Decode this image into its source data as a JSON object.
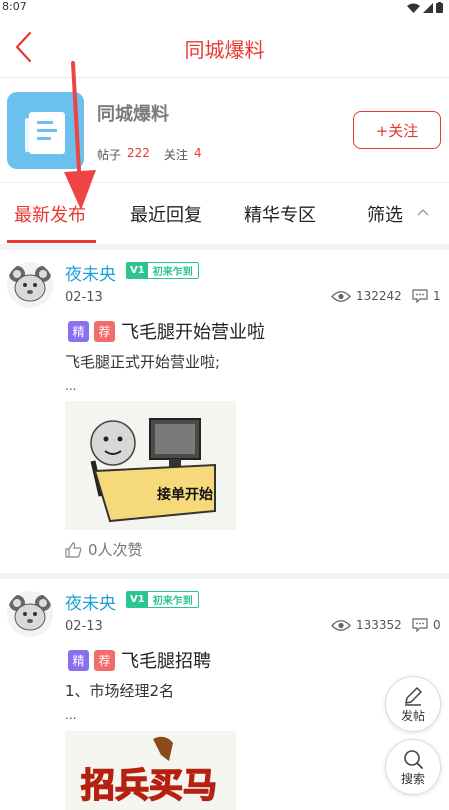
{
  "status_bar": {
    "time": "8:07"
  },
  "nav": {
    "title": "同城爆料"
  },
  "forum": {
    "name": "同城爆料",
    "posts_label": "帖子",
    "posts_count": "222",
    "follow_label": "关注",
    "follow_count": "4",
    "follow_button": "+关注"
  },
  "tabs": [
    {
      "label": "最新发布",
      "active": true
    },
    {
      "label": "最近回复"
    },
    {
      "label": "精华专区"
    },
    {
      "label": "筛选"
    }
  ],
  "posts": [
    {
      "username": "夜未央",
      "level_code": "V1",
      "level_title": "初来乍到",
      "date": "02-13",
      "views": "132242",
      "comments": "1",
      "tags": [
        "精",
        "荐"
      ],
      "title": "飞毛腿开始营业啦",
      "excerpt": "飞毛腿正式开始营业啦;",
      "ellipsis": "...",
      "image_caption": "接单开始",
      "likes": "0人次赞"
    },
    {
      "username": "夜未央",
      "level_code": "V1",
      "level_title": "初来乍到",
      "date": "02-13",
      "views": "133352",
      "comments": "0",
      "tags": [
        "精",
        "荐"
      ],
      "title": "飞毛腿招聘",
      "excerpt": "1、市场经理2名",
      "ellipsis": "...",
      "image_caption": "招兵买马"
    }
  ],
  "fab": {
    "post_label": "发帖",
    "search_label": "搜索"
  },
  "colors": {
    "accent": "#e8382f",
    "username": "#1ea0d6",
    "badge": "#2bc58f",
    "tag_jing": "#8a6ff2",
    "tag_jian": "#f26c6c"
  }
}
